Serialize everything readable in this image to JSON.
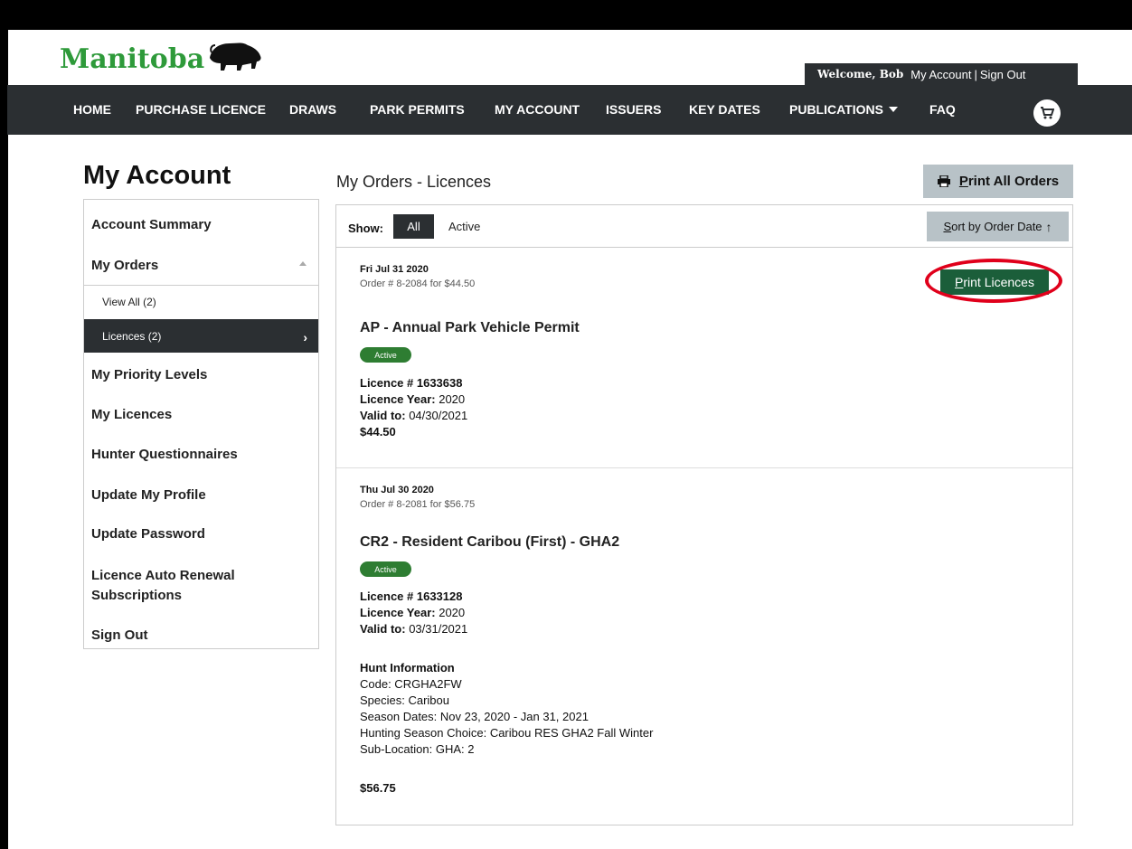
{
  "header": {
    "logo_text": "Manitoba",
    "welcome": "Welcome, Bob",
    "my_account_link": "My Account",
    "separator": "|",
    "sign_out_link": "Sign Out"
  },
  "nav": {
    "items": [
      "HOME",
      "PURCHASE LICENCE",
      "DRAWS",
      "PARK PERMITS",
      "MY ACCOUNT",
      "ISSUERS",
      "KEY DATES",
      "PUBLICATIONS",
      "FAQ"
    ]
  },
  "sidebar": {
    "title": "My Account",
    "items": {
      "account_summary": "Account Summary",
      "my_orders": "My Orders",
      "view_all": "View All (2)",
      "licences": "Licences (2)",
      "priority_levels": "My Priority Levels",
      "my_licences": "My Licences",
      "hunter_questionnaires": "Hunter Questionnaires",
      "update_profile": "Update My Profile",
      "update_password": "Update Password",
      "auto_renewal_1": "Licence Auto Renewal",
      "auto_renewal_2": "Subscriptions",
      "sign_out": "Sign Out"
    }
  },
  "main": {
    "title": "My Orders - Licences",
    "print_all_first": "P",
    "print_all_rest": "rint All Orders",
    "show_label": "Show:",
    "filter_all": "All",
    "filter_active": "Active",
    "sort_first": "S",
    "sort_rest": "ort by Order Date",
    "sort_arrow": "↑"
  },
  "orders": [
    {
      "date": "Fri Jul 31 2020",
      "order_line": "Order # 8-2084 for $44.50",
      "title": "AP - Annual Park Vehicle Permit",
      "status": "Active",
      "licence_no": "Licence # 1633638",
      "year_label": "Licence Year:",
      "year": "2020",
      "valid_label": "Valid to:",
      "valid": "04/30/2021",
      "price": "$44.50",
      "print_first": "P",
      "print_rest": "rint Licences"
    },
    {
      "date": "Thu Jul 30 2020",
      "order_line": "Order # 8-2081 for $56.75",
      "title": "CR2 - Resident Caribou (First) - GHA2",
      "status": "Active",
      "licence_no": "Licence # 1633128",
      "year_label": "Licence Year:",
      "year": "2020",
      "valid_label": "Valid to:",
      "valid": "03/31/2021",
      "hunt_heading": "Hunt Information",
      "code": "Code:  CRGHA2FW",
      "species": "Species:  Caribou",
      "season": "Season Dates:  Nov 23, 2020 - Jan 31, 2021",
      "choice": "Hunting Season Choice:  Caribou RES GHA2 Fall Winter",
      "sublocation": "Sub-Location:  GHA: 2",
      "price": "$56.75"
    }
  ],
  "colors": {
    "nav_bg": "#2b2f32",
    "brand_green": "#2e9a3a",
    "badge_green": "#2e7d32",
    "print_button": "#1b5e3a",
    "highlight_ring": "#e0001b"
  }
}
